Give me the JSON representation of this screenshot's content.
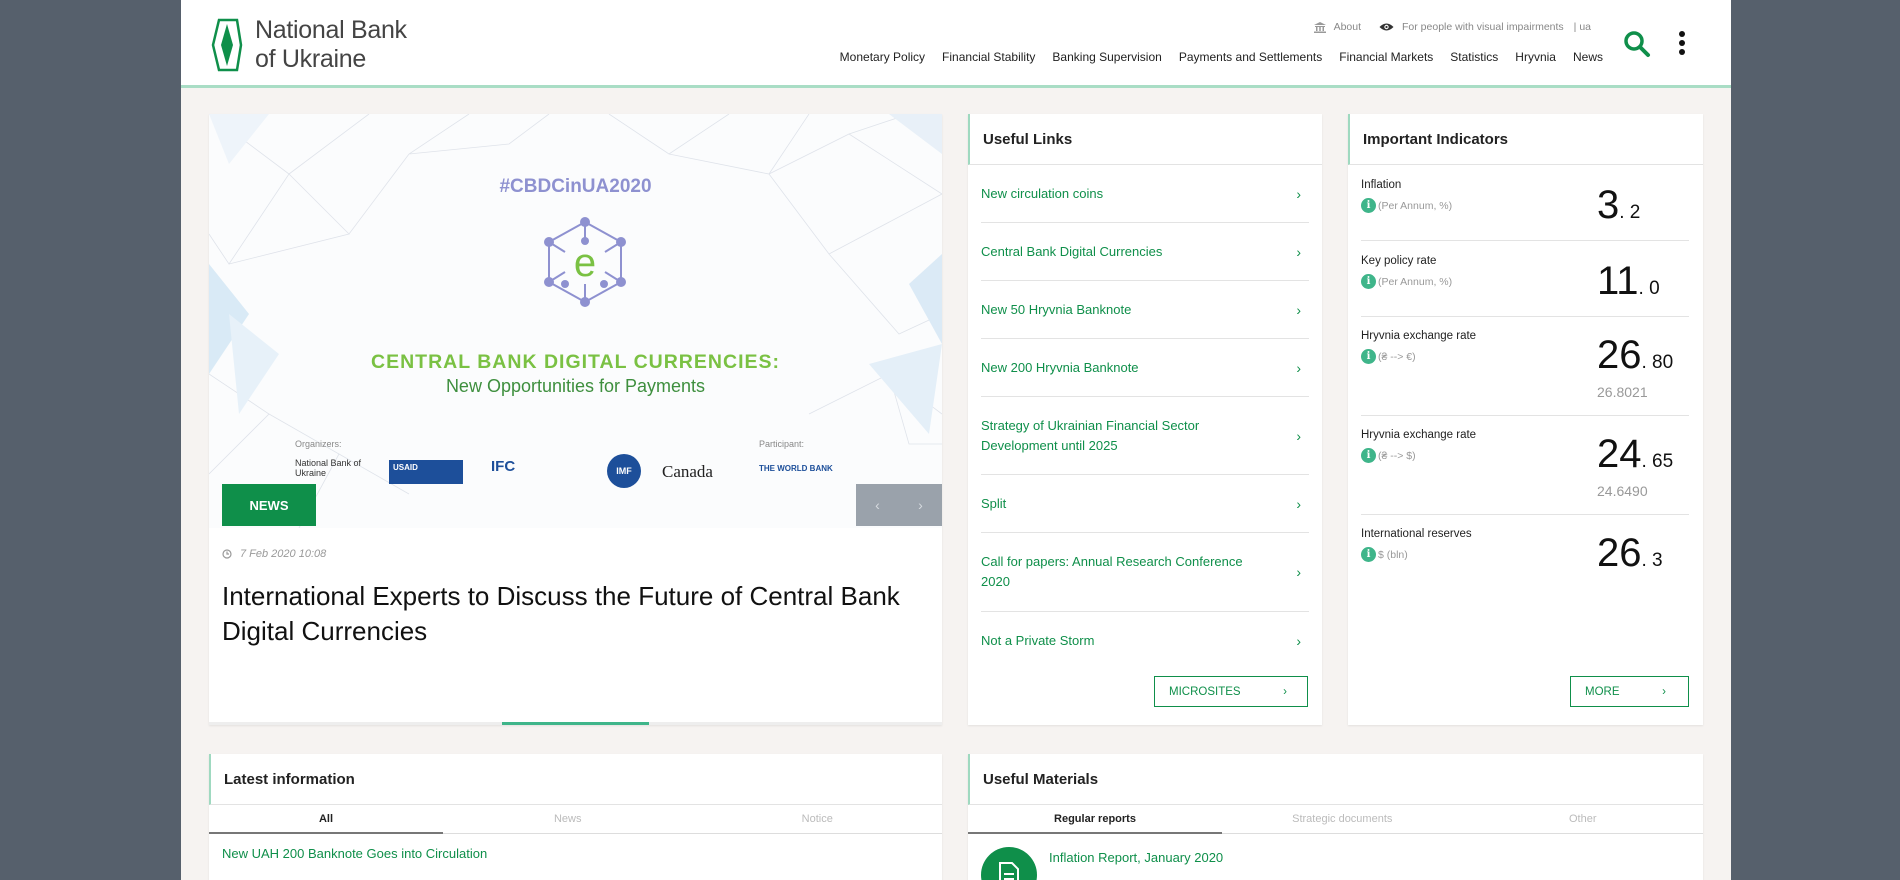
{
  "brand": {
    "name_line1": "National Bank",
    "name_line2": "of Ukraine"
  },
  "toplinks": {
    "about": "About",
    "visual": "For people with visual impairments",
    "lang": "| ua"
  },
  "nav": [
    "Monetary Policy",
    "Financial Stability",
    "Banking Supervision",
    "Payments and Settlements",
    "Financial Markets",
    "Statistics",
    "Hryvnia",
    "News"
  ],
  "slider": {
    "hashtag": "#CBDCinUA2020",
    "banner_title": "CENTRAL BANK DIGITAL CURRENCIES:",
    "banner_subtitle": "New Opportunities for Payments",
    "organizers_label": "Organizers:",
    "participant_label": "Participant:",
    "logos": [
      "National Bank of Ukraine",
      "USAID",
      "IFC",
      "IMF",
      "Canada",
      "THE WORLD BANK"
    ],
    "badge": "NEWS",
    "prev": "‹",
    "next": "›",
    "date": "7 Feb 2020 10:08",
    "headline": "International Experts to Discuss the Future of Central Bank Digital Currencies",
    "progress_fraction": 0.2
  },
  "useful_links": {
    "title": "Useful Links",
    "items": [
      "New circulation coins",
      "Central Bank Digital Currencies",
      "New 50 Hryvnia Banknote",
      "New 200 Hryvnia Banknote",
      "Strategy of Ukrainian Financial Sector Development until 2025",
      "Split",
      "Call for papers: Annual Research Conference 2020",
      "Not a Private Storm"
    ],
    "button": "MICROSITES"
  },
  "indicators": {
    "title": "Important Indicators",
    "items": [
      {
        "name": "Inflation",
        "sub": "(Per Annum, %)",
        "int": "3",
        "dec": ". 2",
        "secondary": ""
      },
      {
        "name": "Key policy rate",
        "sub": "(Per Annum, %)",
        "int": "11",
        "dec": ". 0",
        "secondary": ""
      },
      {
        "name": "Hryvnia exchange rate",
        "sub": "(₴ --> €)",
        "int": "26",
        "dec": ". 80",
        "secondary": "26.8021"
      },
      {
        "name": "Hryvnia exchange rate",
        "sub": "(₴ --> $)",
        "int": "24",
        "dec": ". 65",
        "secondary": "24.6490"
      },
      {
        "name": "International reserves",
        "sub": "$ (bln)",
        "int": "26",
        "dec": ". 3",
        "secondary": ""
      }
    ],
    "button": "MORE"
  },
  "latest": {
    "title": "Latest information",
    "tabs": [
      "All",
      "News",
      "Notice"
    ],
    "first_item": "New UAH 200 Banknote Goes into Circulation"
  },
  "materials": {
    "title": "Useful Materials",
    "tabs": [
      "Regular reports",
      "Strategic documents",
      "Other"
    ],
    "first_item": "Inflation Report, January 2020"
  },
  "colors": {
    "accent": "#0f8f4a",
    "accent_light": "#3fb58a",
    "backdrop": "#56606c"
  }
}
